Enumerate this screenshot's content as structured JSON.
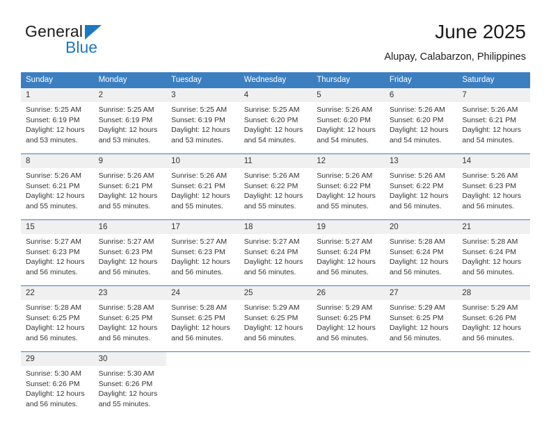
{
  "brand": {
    "name_top": "General",
    "name_bottom": "Blue",
    "accent_color": "#1c78c0"
  },
  "header": {
    "title": "June 2025",
    "location": "Alupay, Calabarzon, Philippines"
  },
  "calendar": {
    "header_bg": "#3c7fc1",
    "daynum_bg": "#f0f0f0",
    "weekdays": [
      "Sunday",
      "Monday",
      "Tuesday",
      "Wednesday",
      "Thursday",
      "Friday",
      "Saturday"
    ],
    "weeks": [
      [
        {
          "day": "1",
          "sunrise": "Sunrise: 5:25 AM",
          "sunset": "Sunset: 6:19 PM",
          "daylight1": "Daylight: 12 hours",
          "daylight2": "and 53 minutes."
        },
        {
          "day": "2",
          "sunrise": "Sunrise: 5:25 AM",
          "sunset": "Sunset: 6:19 PM",
          "daylight1": "Daylight: 12 hours",
          "daylight2": "and 53 minutes."
        },
        {
          "day": "3",
          "sunrise": "Sunrise: 5:25 AM",
          "sunset": "Sunset: 6:19 PM",
          "daylight1": "Daylight: 12 hours",
          "daylight2": "and 53 minutes."
        },
        {
          "day": "4",
          "sunrise": "Sunrise: 5:25 AM",
          "sunset": "Sunset: 6:20 PM",
          "daylight1": "Daylight: 12 hours",
          "daylight2": "and 54 minutes."
        },
        {
          "day": "5",
          "sunrise": "Sunrise: 5:26 AM",
          "sunset": "Sunset: 6:20 PM",
          "daylight1": "Daylight: 12 hours",
          "daylight2": "and 54 minutes."
        },
        {
          "day": "6",
          "sunrise": "Sunrise: 5:26 AM",
          "sunset": "Sunset: 6:20 PM",
          "daylight1": "Daylight: 12 hours",
          "daylight2": "and 54 minutes."
        },
        {
          "day": "7",
          "sunrise": "Sunrise: 5:26 AM",
          "sunset": "Sunset: 6:21 PM",
          "daylight1": "Daylight: 12 hours",
          "daylight2": "and 54 minutes."
        }
      ],
      [
        {
          "day": "8",
          "sunrise": "Sunrise: 5:26 AM",
          "sunset": "Sunset: 6:21 PM",
          "daylight1": "Daylight: 12 hours",
          "daylight2": "and 55 minutes."
        },
        {
          "day": "9",
          "sunrise": "Sunrise: 5:26 AM",
          "sunset": "Sunset: 6:21 PM",
          "daylight1": "Daylight: 12 hours",
          "daylight2": "and 55 minutes."
        },
        {
          "day": "10",
          "sunrise": "Sunrise: 5:26 AM",
          "sunset": "Sunset: 6:21 PM",
          "daylight1": "Daylight: 12 hours",
          "daylight2": "and 55 minutes."
        },
        {
          "day": "11",
          "sunrise": "Sunrise: 5:26 AM",
          "sunset": "Sunset: 6:22 PM",
          "daylight1": "Daylight: 12 hours",
          "daylight2": "and 55 minutes."
        },
        {
          "day": "12",
          "sunrise": "Sunrise: 5:26 AM",
          "sunset": "Sunset: 6:22 PM",
          "daylight1": "Daylight: 12 hours",
          "daylight2": "and 55 minutes."
        },
        {
          "day": "13",
          "sunrise": "Sunrise: 5:26 AM",
          "sunset": "Sunset: 6:22 PM",
          "daylight1": "Daylight: 12 hours",
          "daylight2": "and 56 minutes."
        },
        {
          "day": "14",
          "sunrise": "Sunrise: 5:26 AM",
          "sunset": "Sunset: 6:23 PM",
          "daylight1": "Daylight: 12 hours",
          "daylight2": "and 56 minutes."
        }
      ],
      [
        {
          "day": "15",
          "sunrise": "Sunrise: 5:27 AM",
          "sunset": "Sunset: 6:23 PM",
          "daylight1": "Daylight: 12 hours",
          "daylight2": "and 56 minutes."
        },
        {
          "day": "16",
          "sunrise": "Sunrise: 5:27 AM",
          "sunset": "Sunset: 6:23 PM",
          "daylight1": "Daylight: 12 hours",
          "daylight2": "and 56 minutes."
        },
        {
          "day": "17",
          "sunrise": "Sunrise: 5:27 AM",
          "sunset": "Sunset: 6:23 PM",
          "daylight1": "Daylight: 12 hours",
          "daylight2": "and 56 minutes."
        },
        {
          "day": "18",
          "sunrise": "Sunrise: 5:27 AM",
          "sunset": "Sunset: 6:24 PM",
          "daylight1": "Daylight: 12 hours",
          "daylight2": "and 56 minutes."
        },
        {
          "day": "19",
          "sunrise": "Sunrise: 5:27 AM",
          "sunset": "Sunset: 6:24 PM",
          "daylight1": "Daylight: 12 hours",
          "daylight2": "and 56 minutes."
        },
        {
          "day": "20",
          "sunrise": "Sunrise: 5:28 AM",
          "sunset": "Sunset: 6:24 PM",
          "daylight1": "Daylight: 12 hours",
          "daylight2": "and 56 minutes."
        },
        {
          "day": "21",
          "sunrise": "Sunrise: 5:28 AM",
          "sunset": "Sunset: 6:24 PM",
          "daylight1": "Daylight: 12 hours",
          "daylight2": "and 56 minutes."
        }
      ],
      [
        {
          "day": "22",
          "sunrise": "Sunrise: 5:28 AM",
          "sunset": "Sunset: 6:25 PM",
          "daylight1": "Daylight: 12 hours",
          "daylight2": "and 56 minutes."
        },
        {
          "day": "23",
          "sunrise": "Sunrise: 5:28 AM",
          "sunset": "Sunset: 6:25 PM",
          "daylight1": "Daylight: 12 hours",
          "daylight2": "and 56 minutes."
        },
        {
          "day": "24",
          "sunrise": "Sunrise: 5:28 AM",
          "sunset": "Sunset: 6:25 PM",
          "daylight1": "Daylight: 12 hours",
          "daylight2": "and 56 minutes."
        },
        {
          "day": "25",
          "sunrise": "Sunrise: 5:29 AM",
          "sunset": "Sunset: 6:25 PM",
          "daylight1": "Daylight: 12 hours",
          "daylight2": "and 56 minutes."
        },
        {
          "day": "26",
          "sunrise": "Sunrise: 5:29 AM",
          "sunset": "Sunset: 6:25 PM",
          "daylight1": "Daylight: 12 hours",
          "daylight2": "and 56 minutes."
        },
        {
          "day": "27",
          "sunrise": "Sunrise: 5:29 AM",
          "sunset": "Sunset: 6:25 PM",
          "daylight1": "Daylight: 12 hours",
          "daylight2": "and 56 minutes."
        },
        {
          "day": "28",
          "sunrise": "Sunrise: 5:29 AM",
          "sunset": "Sunset: 6:26 PM",
          "daylight1": "Daylight: 12 hours",
          "daylight2": "and 56 minutes."
        }
      ],
      [
        {
          "day": "29",
          "sunrise": "Sunrise: 5:30 AM",
          "sunset": "Sunset: 6:26 PM",
          "daylight1": "Daylight: 12 hours",
          "daylight2": "and 56 minutes."
        },
        {
          "day": "30",
          "sunrise": "Sunrise: 5:30 AM",
          "sunset": "Sunset: 6:26 PM",
          "daylight1": "Daylight: 12 hours",
          "daylight2": "and 55 minutes."
        },
        {
          "day": "",
          "sunrise": "",
          "sunset": "",
          "daylight1": "",
          "daylight2": ""
        },
        {
          "day": "",
          "sunrise": "",
          "sunset": "",
          "daylight1": "",
          "daylight2": ""
        },
        {
          "day": "",
          "sunrise": "",
          "sunset": "",
          "daylight1": "",
          "daylight2": ""
        },
        {
          "day": "",
          "sunrise": "",
          "sunset": "",
          "daylight1": "",
          "daylight2": ""
        },
        {
          "day": "",
          "sunrise": "",
          "sunset": "",
          "daylight1": "",
          "daylight2": ""
        }
      ]
    ]
  }
}
